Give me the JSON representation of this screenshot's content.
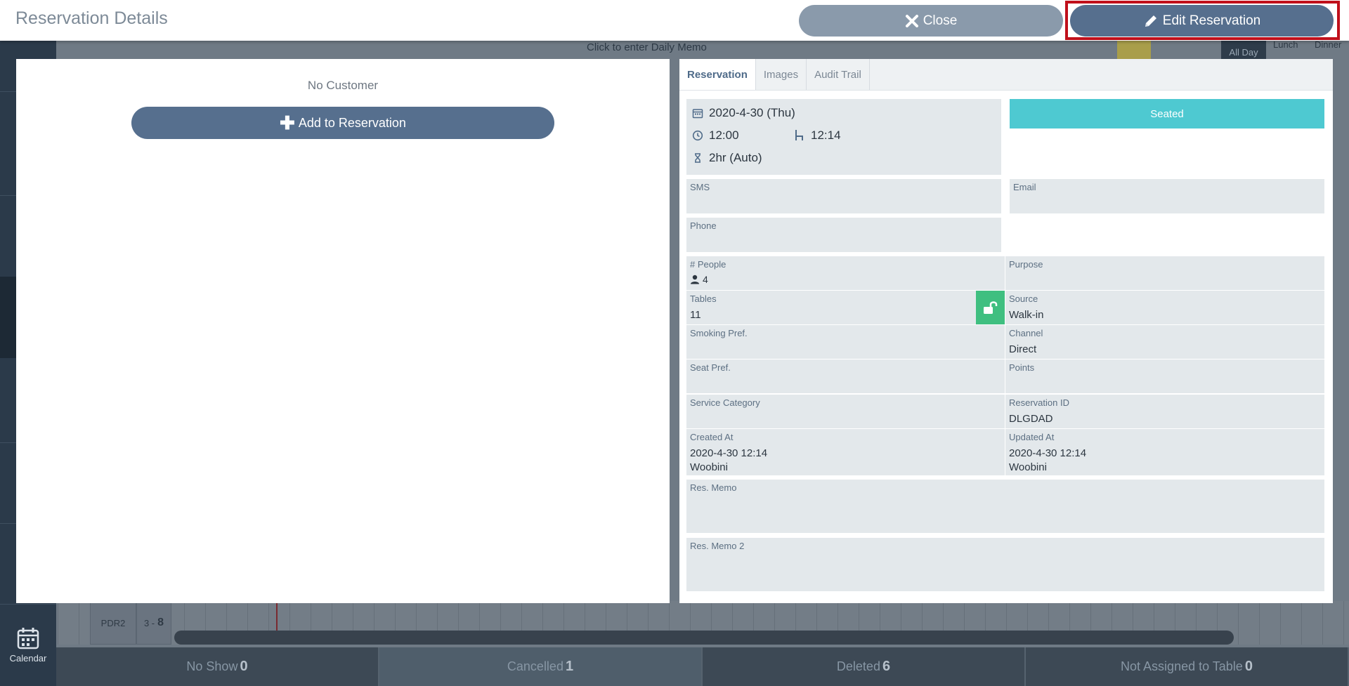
{
  "header": {
    "title": "Reservation Details",
    "close_label": "Close",
    "edit_label": "Edit Reservation"
  },
  "left": {
    "no_customer": "No Customer",
    "add_label": "Add to Reservation"
  },
  "tabs": [
    "Reservation",
    "Images",
    "Audit Trail"
  ],
  "reservation": {
    "date": "2020-4-30 (Thu)",
    "time": "12:00",
    "seated_time": "12:14",
    "duration": "2hr (Auto)",
    "status_label": "Seated",
    "sms_label": "SMS",
    "email_label": "Email",
    "phone_label": "Phone",
    "people_label": "# People",
    "people_value": "4",
    "purpose_label": "Purpose",
    "tables_label": "Tables",
    "tables_value": "11",
    "source_label": "Source",
    "source_value": "Walk-in",
    "smoking_label": "Smoking Pref.",
    "channel_label": "Channel",
    "channel_value": "Direct",
    "seat_label": "Seat Pref.",
    "points_label": "Points",
    "service_label": "Service Category",
    "resid_label": "Reservation ID",
    "resid_value": "DLGDAD",
    "created_label": "Created At",
    "created_value": "2020-4-30 12:14",
    "created_by": "Woobini",
    "updated_label": "Updated At",
    "updated_value": "2020-4-30 12:14",
    "updated_by": "Woobini",
    "memo_label": "Res. Memo",
    "memo2_label": "Res. Memo 2"
  },
  "background": {
    "daily_memo": "Click to enter Daily Memo",
    "row_name": "PDR2",
    "row_range": "3 -",
    "row_count": "8",
    "calendar_label": "Calendar",
    "all_day": "All Day",
    "lunch": "Lunch",
    "dinner": "Dinner",
    "footer": [
      {
        "label": "No Show",
        "count": "0"
      },
      {
        "label": "Cancelled",
        "count": "1"
      },
      {
        "label": "Deleted",
        "count": "6"
      },
      {
        "label": "Not Assigned to Table",
        "count": "0"
      }
    ]
  },
  "colors": {
    "primary": "#566f8e",
    "close": "#8a9aab",
    "seated": "#4ec9d1",
    "lock": "#3fbf80",
    "highlight": "#c0101b"
  }
}
